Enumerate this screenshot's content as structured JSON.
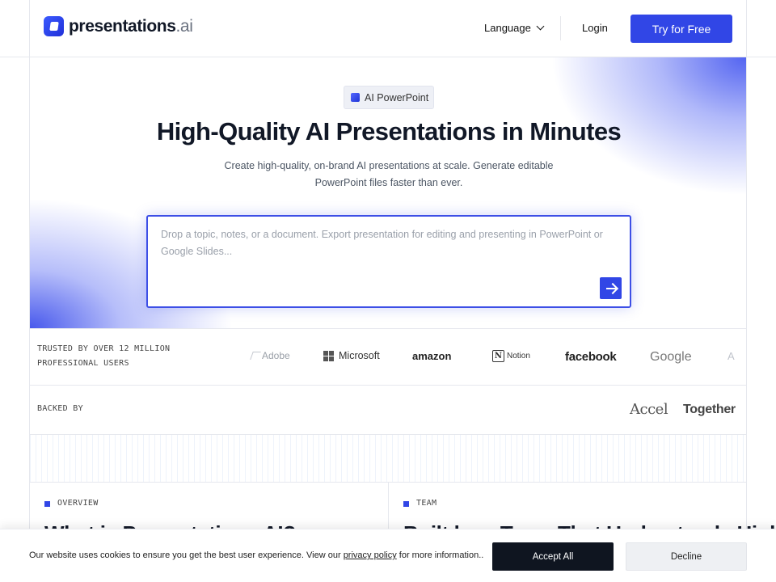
{
  "header": {
    "logo_text": "presentations",
    "logo_suffix": ".ai",
    "language_label": "Language",
    "login_label": "Login",
    "try_label": "Try for Free"
  },
  "hero": {
    "badge": "AI PowerPoint",
    "title": "High-Quality AI Presentations in Minutes",
    "subtitle": "Create high-quality, on-brand AI presentations at scale. Generate editable PowerPoint files faster than ever.",
    "prompt_placeholder": "Drop a topic, notes, or a document. Export presentation for editing and presenting in PowerPoint or Google Slides...",
    "prompt_value": ""
  },
  "trusted": {
    "label_line1": "TRUSTED BY OVER 12 MILLION",
    "label_line2": "PROFESSIONAL USERS",
    "logos": [
      "Adobe",
      "Microsoft",
      "amazon",
      "Notion",
      "facebook",
      "Google",
      "A"
    ]
  },
  "backed": {
    "label": "BACKED BY",
    "investors": [
      "Accel",
      "Together"
    ]
  },
  "cards": [
    {
      "tag": "OVERVIEW",
      "title": "What is Presentations.AI?"
    },
    {
      "tag": "TEAM",
      "title": "Built by a Team That Understands High"
    }
  ],
  "cookie": {
    "text_before": "Our website uses cookies to ensure you get the best user experience. View our ",
    "link": "privacy policy",
    "text_after": " for more information..",
    "accept_label": "Accept All",
    "decline_label": "Decline"
  },
  "colors": {
    "brand": "#3146e6",
    "accept_bg": "#0f1520"
  },
  "icons": {
    "chevron": "chevron-down-icon",
    "send": "arrow-right-icon"
  }
}
